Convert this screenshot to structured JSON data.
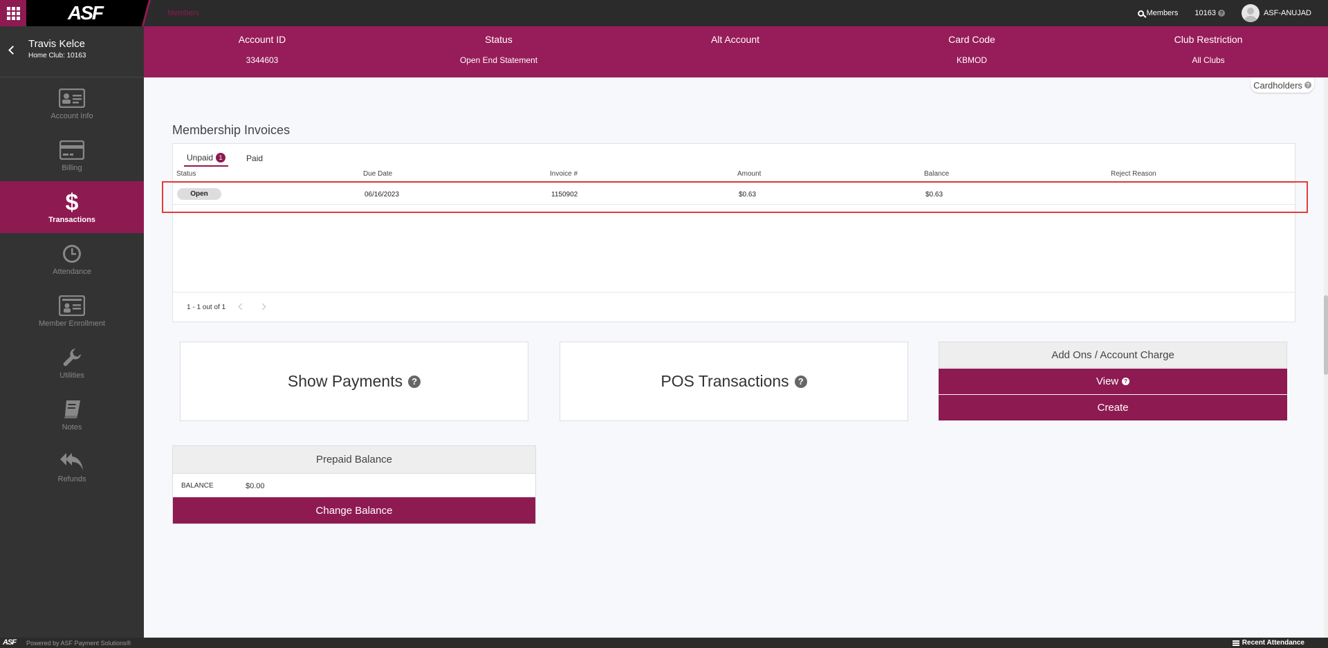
{
  "topbar": {
    "logo": "ASF",
    "breadcrumb": "Members",
    "search_label": "Members",
    "club_id": "10163",
    "user": "ASF-ANUJAD"
  },
  "member": {
    "name": "Travis Kelce",
    "home_club": "Home Club: 10163"
  },
  "sidebar": {
    "items": [
      {
        "label": "Account Info",
        "icon": "id-card-icon"
      },
      {
        "label": "Billing",
        "icon": "credit-card-icon"
      },
      {
        "label": "Transactions",
        "icon": "dollar-icon"
      },
      {
        "label": "Attendance",
        "icon": "clock-icon"
      },
      {
        "label": "Member Enrollment",
        "icon": "enroll-card-icon"
      },
      {
        "label": "Utilities",
        "icon": "wrench-icon"
      },
      {
        "label": "Notes",
        "icon": "notebook-icon"
      },
      {
        "label": "Refunds",
        "icon": "reply-all-icon"
      }
    ],
    "active": "Transactions"
  },
  "account": {
    "columns": [
      {
        "header": "Account ID",
        "value": "3344603"
      },
      {
        "header": "Status",
        "value": "Open End Statement"
      },
      {
        "header": "Alt Account",
        "value": ""
      },
      {
        "header": "Card Code",
        "value": "KBMOD"
      },
      {
        "header": "Club Restriction",
        "value": "All Clubs"
      }
    ]
  },
  "cardholders_label": "Cardholders",
  "invoices": {
    "title": "Membership Invoices",
    "tabs": {
      "unpaid": "Unpaid",
      "unpaid_count": "1",
      "paid": "Paid"
    },
    "columns": [
      "Status",
      "Due Date",
      "Invoice #",
      "Amount",
      "Balance",
      "Reject Reason"
    ],
    "rows": [
      {
        "status": "Open",
        "due_date": "06/16/2023",
        "invoice": "1150902",
        "amount": "$0.63",
        "balance": "$0.63",
        "reject_reason": ""
      }
    ],
    "pager": "1 - 1 out of 1"
  },
  "cards": {
    "show_payments": "Show Payments",
    "pos_transactions": "POS Transactions"
  },
  "addons": {
    "title": "Add Ons / Account Charge",
    "view": "View",
    "create": "Create"
  },
  "prepaid": {
    "title": "Prepaid Balance",
    "balance_label": "BALANCE",
    "balance_value": "$0.00",
    "change_button": "Change Balance"
  },
  "footer": {
    "logo": "ASF",
    "powered": "Powered by ASF Payment Solutions®",
    "recent": "Recent Attendance"
  },
  "colors": {
    "brand": "#8e1a52",
    "band": "#971c5a",
    "sidebar": "#333333",
    "highlight": "#e53a3a"
  }
}
